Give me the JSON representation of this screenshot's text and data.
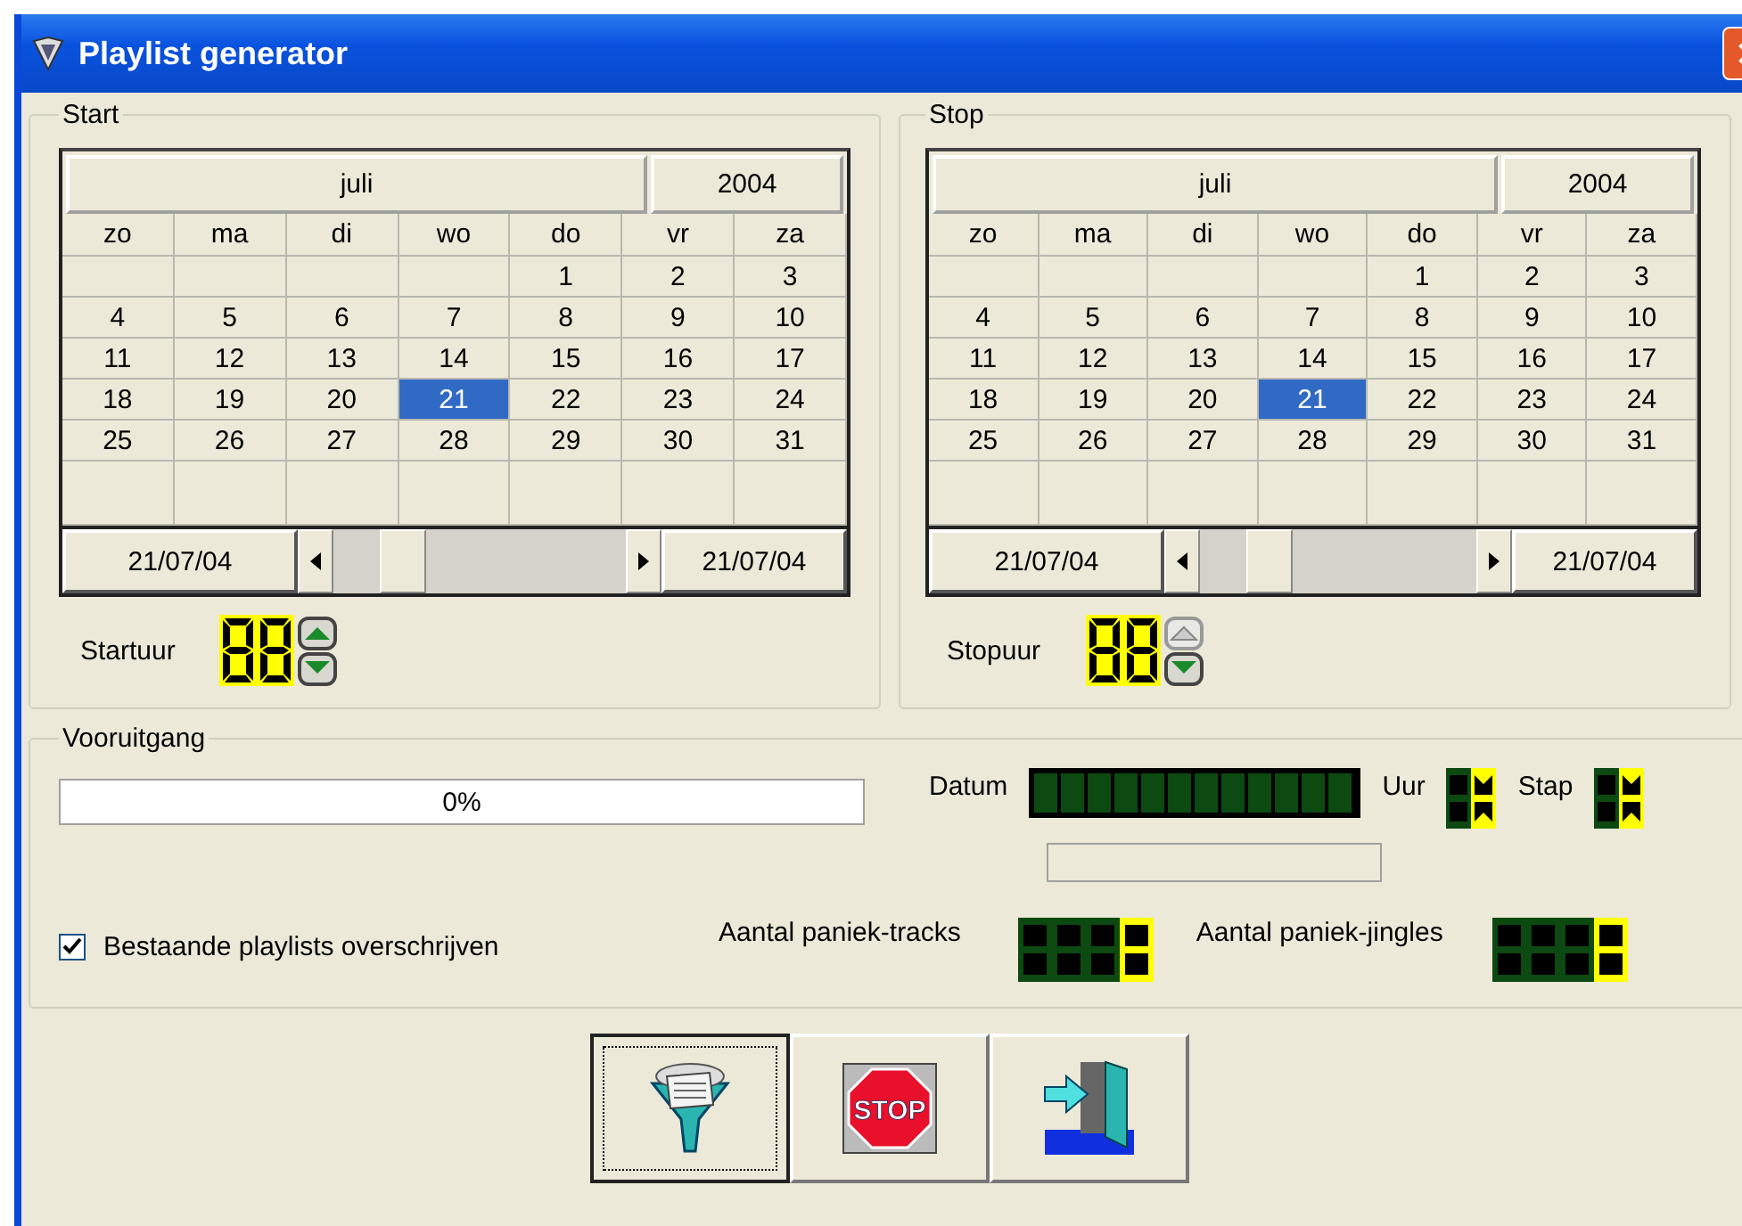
{
  "window": {
    "title": "Playlist generator"
  },
  "panels": [
    {
      "legend": "Start",
      "month": "juli",
      "year": "2004",
      "weekdays": [
        "zo",
        "ma",
        "di",
        "wo",
        "do",
        "vr",
        "za"
      ],
      "weeks": [
        [
          {
            "day": "1",
            "selected": false
          },
          {
            "day": "2",
            "selected": false
          },
          {
            "day": "3",
            "selected": false
          }
        ],
        [
          {
            "day": "4",
            "selected": false
          },
          {
            "day": "5",
            "selected": false
          },
          {
            "day": "6",
            "selected": false
          },
          {
            "day": "7",
            "selected": false
          },
          {
            "day": "8",
            "selected": false
          },
          {
            "day": "9",
            "selected": false
          },
          {
            "day": "10",
            "selected": false
          }
        ],
        [
          {
            "day": "11",
            "selected": false
          },
          {
            "day": "12",
            "selected": false
          },
          {
            "day": "13",
            "selected": false
          },
          {
            "day": "14",
            "selected": false
          },
          {
            "day": "15",
            "selected": false
          },
          {
            "day": "16",
            "selected": false
          },
          {
            "day": "17",
            "selected": false
          }
        ],
        [
          {
            "day": "18",
            "selected": false
          },
          {
            "day": "19",
            "selected": false
          },
          {
            "day": "20",
            "selected": false
          },
          {
            "day": "21",
            "selected": true
          },
          {
            "day": "22",
            "selected": false
          },
          {
            "day": "23",
            "selected": false
          },
          {
            "day": "24",
            "selected": false
          }
        ],
        [
          {
            "day": "25",
            "selected": false
          },
          {
            "day": "26",
            "selected": false
          },
          {
            "day": "27",
            "selected": false
          },
          {
            "day": "28",
            "selected": false
          },
          {
            "day": "29",
            "selected": false
          },
          {
            "day": "30",
            "selected": false
          },
          {
            "day": "31",
            "selected": false
          }
        ]
      ],
      "range_from": "21/07/04",
      "range_to": "21/07/04",
      "time_label": "Startuur",
      "up_disabled": false
    },
    {
      "legend": "Stop",
      "month": "juli",
      "year": "2004",
      "weekdays": [
        "zo",
        "ma",
        "di",
        "wo",
        "do",
        "vr",
        "za"
      ],
      "weeks": [
        [
          {
            "day": "1",
            "selected": false
          },
          {
            "day": "2",
            "selected": false
          },
          {
            "day": "3",
            "selected": false
          }
        ],
        [
          {
            "day": "4",
            "selected": false
          },
          {
            "day": "5",
            "selected": false
          },
          {
            "day": "6",
            "selected": false
          },
          {
            "day": "7",
            "selected": false
          },
          {
            "day": "8",
            "selected": false
          },
          {
            "day": "9",
            "selected": false
          },
          {
            "day": "10",
            "selected": false
          }
        ],
        [
          {
            "day": "11",
            "selected": false
          },
          {
            "day": "12",
            "selected": false
          },
          {
            "day": "13",
            "selected": false
          },
          {
            "day": "14",
            "selected": false
          },
          {
            "day": "15",
            "selected": false
          },
          {
            "day": "16",
            "selected": false
          },
          {
            "day": "17",
            "selected": false
          }
        ],
        [
          {
            "day": "18",
            "selected": false
          },
          {
            "day": "19",
            "selected": false
          },
          {
            "day": "20",
            "selected": false
          },
          {
            "day": "21",
            "selected": true
          },
          {
            "day": "22",
            "selected": false
          },
          {
            "day": "23",
            "selected": false
          },
          {
            "day": "24",
            "selected": false
          }
        ],
        [
          {
            "day": "25",
            "selected": false
          },
          {
            "day": "26",
            "selected": false
          },
          {
            "day": "27",
            "selected": false
          },
          {
            "day": "28",
            "selected": false
          },
          {
            "day": "29",
            "selected": false
          },
          {
            "day": "30",
            "selected": false
          },
          {
            "day": "31",
            "selected": false
          }
        ]
      ],
      "range_from": "21/07/04",
      "range_to": "21/07/04",
      "time_label": "Stopuur",
      "up_disabled": true
    }
  ],
  "progress": {
    "legend": "Vooruitgang",
    "level": 0,
    "reading": "0%",
    "date_label": "Datum",
    "hour_label": "Uur",
    "step_label": "Stap",
    "overwrite": {
      "label": "Bestaande playlists overschrijven",
      "checked": true
    },
    "tracks_label": "Aantal paniek-tracks",
    "jingles_label": "Aantal paniek-jingles"
  },
  "buttons": [
    {
      "kind": "generate",
      "focused": true
    },
    {
      "kind": "stop",
      "sign": "STOP",
      "focused": false
    },
    {
      "kind": "exit",
      "focused": false
    }
  ]
}
